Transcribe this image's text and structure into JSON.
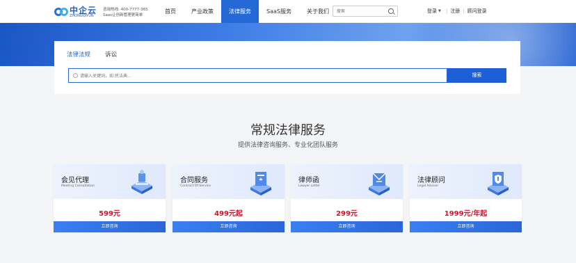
{
  "header": {
    "logo_cn": "中企云",
    "logo_en": "ZHONGQIYUN",
    "hotline": "咨询热线: 400-7777-365",
    "slogan": "Saas让创新管理更简单",
    "nav": [
      {
        "label": "首页",
        "active": false
      },
      {
        "label": "产业政策",
        "active": false
      },
      {
        "label": "法律服务",
        "active": true
      },
      {
        "label": "SaaS服务",
        "active": false
      },
      {
        "label": "关于我们",
        "active": false
      }
    ],
    "search_placeholder": "搜索",
    "login": "登录",
    "register": "注册",
    "advisor_login": "顾问登录"
  },
  "search_section": {
    "tabs": [
      {
        "label": "法律法规",
        "active": true
      },
      {
        "label": "诉讼",
        "active": false
      }
    ],
    "placeholder": "请输入关键词，如:民法典...",
    "button": "搜索"
  },
  "services": {
    "title": "常规法律服务",
    "subtitle": "提供法律咨询服务、专业化团队服务",
    "cards": [
      {
        "title": "会见代理",
        "subtitle": "Meeting Consultation",
        "price": "599元",
        "button": "立即咨询",
        "icon": "meeting-illustration-icon"
      },
      {
        "title": "合同服务",
        "subtitle": "Contract Of Service",
        "price": "499元起",
        "button": "立即咨询",
        "icon": "contract-illustration-icon"
      },
      {
        "title": "律师函",
        "subtitle": "Lawyer Letter",
        "price": "299元",
        "button": "立即咨询",
        "icon": "letter-illustration-icon"
      },
      {
        "title": "法律顾问",
        "subtitle": "Legal Adviser",
        "price": "1999元/年起",
        "button": "立即咨询",
        "icon": "adviser-illustration-icon"
      }
    ]
  },
  "colors": {
    "primary": "#2569d6",
    "price": "#d0112b",
    "banner": "#1a57c6"
  }
}
